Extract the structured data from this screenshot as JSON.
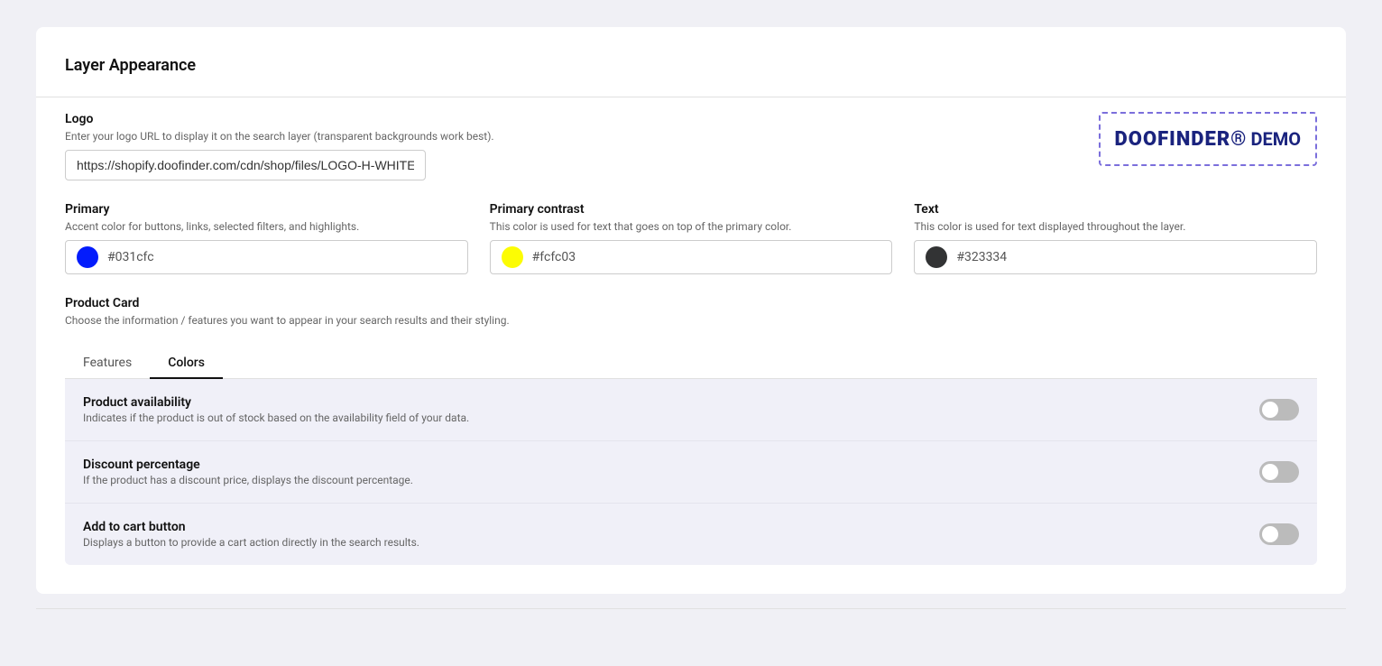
{
  "page": {
    "title": "Layer Appearance"
  },
  "logo": {
    "label": "Logo",
    "description": "Enter your logo URL to display it on the search layer (transparent backgrounds work best).",
    "value": "https://shopify.doofinder.com/cdn/shop/files/LOGO-H-WHITE",
    "preview_text": "DOOFINDER®",
    "preview_demo": "DEMO"
  },
  "colors": {
    "primary": {
      "label": "Primary",
      "description": "Accent color for buttons, links, selected filters, and highlights.",
      "value": "#031cfc",
      "swatch": "#031cfc"
    },
    "primary_contrast": {
      "label": "Primary contrast",
      "description": "This color is used for text that goes on top of the primary color.",
      "value": "#fcfc03",
      "swatch": "#fcfc03"
    },
    "text": {
      "label": "Text",
      "description": "This color is used for text displayed throughout the layer.",
      "value": "#323334",
      "swatch": "#323334"
    }
  },
  "product_card": {
    "label": "Product Card",
    "description": "Choose the information / features you want to appear in your search results and their styling.",
    "tabs": [
      {
        "id": "features",
        "label": "Features",
        "active": false
      },
      {
        "id": "colors",
        "label": "Colors",
        "active": true
      }
    ],
    "features": [
      {
        "title": "Product availability",
        "description": "Indicates if the product is out of stock based on the availability field of your data.",
        "enabled": false
      },
      {
        "title": "Discount percentage",
        "description": "If the product has a discount price, displays the discount percentage.",
        "enabled": false
      },
      {
        "title": "Add to cart button",
        "description": "Displays a button to provide a cart action directly in the search results.",
        "enabled": false
      }
    ]
  }
}
